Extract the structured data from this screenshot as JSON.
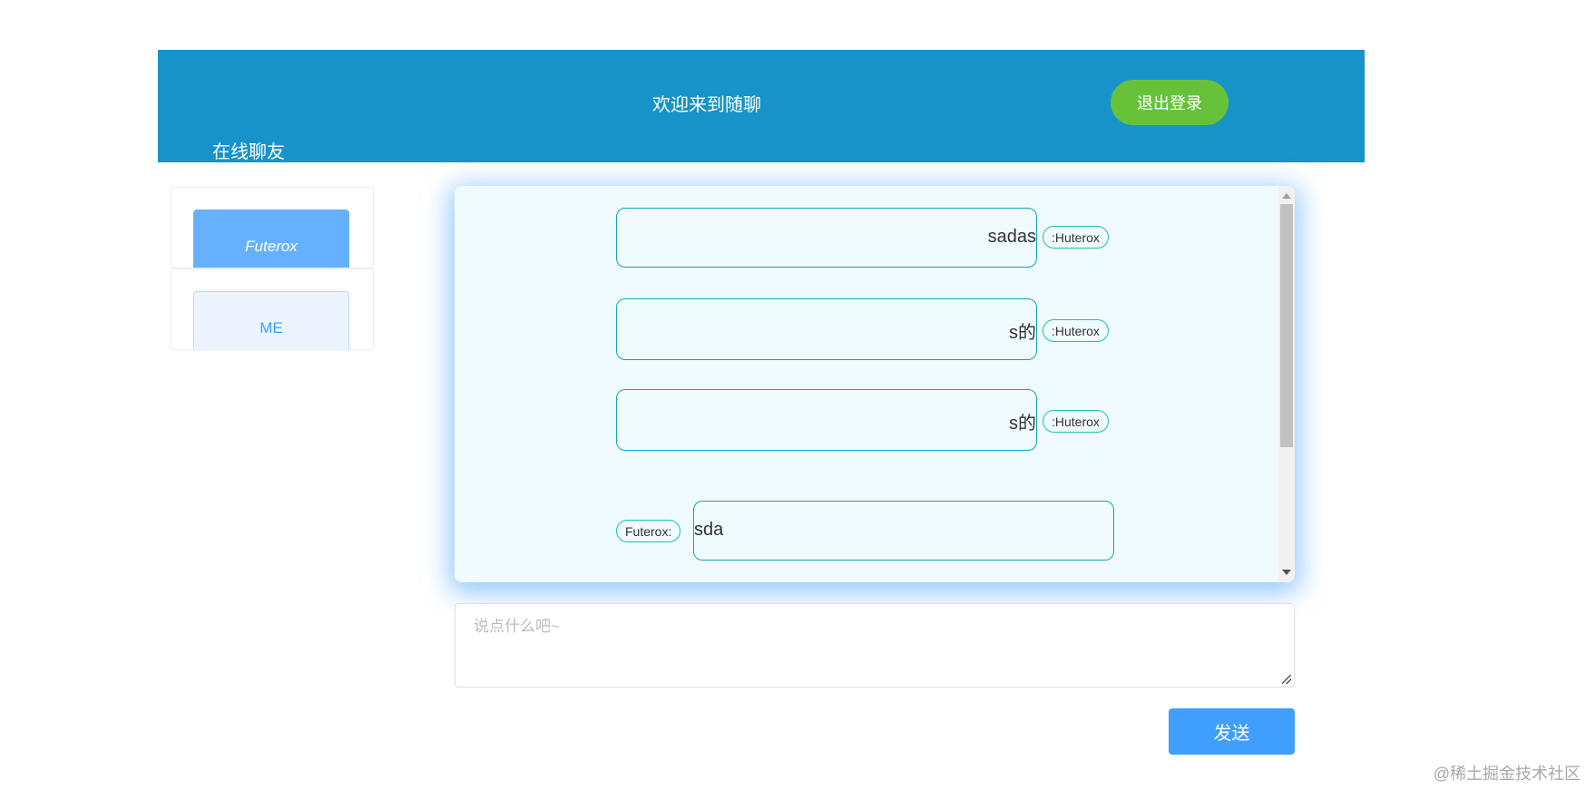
{
  "header": {
    "title": "欢迎来到随聊",
    "logout_label": "退出登录",
    "online_label": "在线聊友"
  },
  "sidebar": {
    "friends": [
      {
        "label": "Futerox",
        "active": true
      },
      {
        "label": "ME",
        "active": false
      }
    ]
  },
  "chat": {
    "messages": [
      {
        "text": "sadas",
        "sender": ":Huterox",
        "side": "right"
      },
      {
        "text": "s的",
        "sender": ":Huterox",
        "side": "right"
      },
      {
        "text": "s的",
        "sender": ":Huterox",
        "side": "right"
      },
      {
        "text": "sda",
        "sender": "Futerox:",
        "side": "left"
      }
    ]
  },
  "composer": {
    "placeholder": "说点什么吧~",
    "send_label": "发送"
  },
  "watermark": "@稀土掘金技术社区",
  "colors": {
    "header_bg": "#1893c9",
    "logout_bg": "#67c23a",
    "send_bg": "#409eff",
    "active_friend_bg": "#66b1ff",
    "chat_bg": "#f0fbff",
    "bubble_border": "#17a2b8"
  }
}
